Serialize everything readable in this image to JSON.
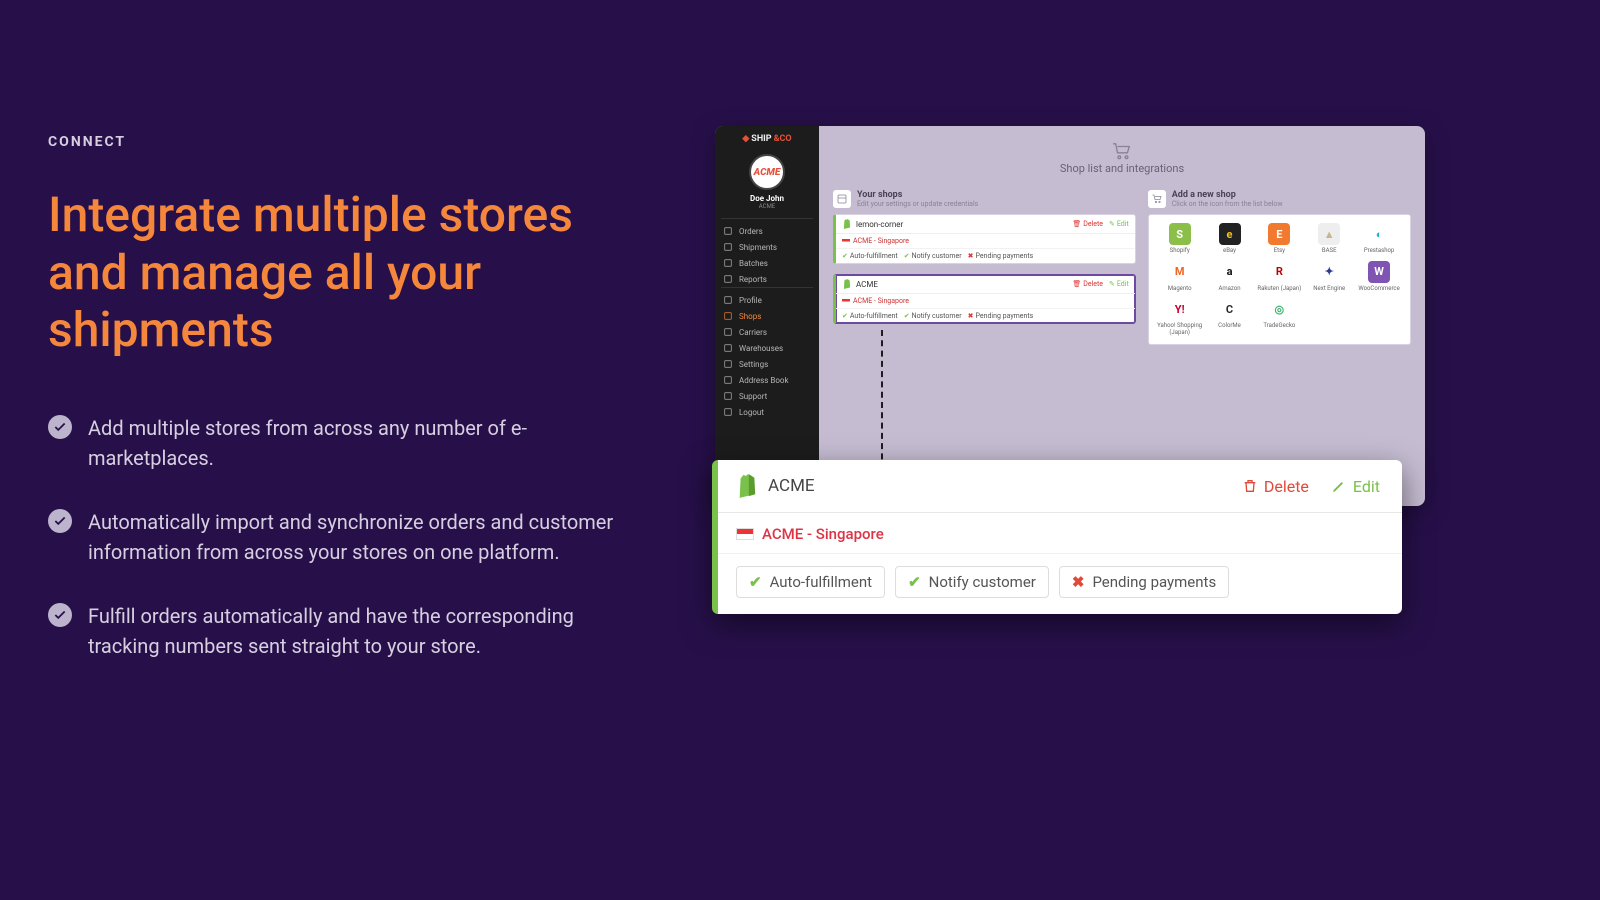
{
  "copy": {
    "eyebrow": "CONNECT",
    "headline": "Integrate multiple stores and manage all your shipments",
    "bullets": [
      "Add multiple stores from across any number of e-marketplaces.",
      "Automatically import and synchronize orders and customer information from across your stores on one platform.",
      "Fulfill orders automatically and have the corresponding tracking numbers sent straight to your store."
    ]
  },
  "screenshot": {
    "logo_a": "SHIP",
    "logo_b": "&CO",
    "avatar": "ACME",
    "user_name": "Doe John",
    "user_sub": "ACME",
    "nav_primary": [
      {
        "icon": "box",
        "label": "Orders"
      },
      {
        "icon": "cube",
        "label": "Shipments"
      },
      {
        "icon": "stack",
        "label": "Batches"
      },
      {
        "icon": "chart",
        "label": "Reports"
      }
    ],
    "nav_secondary": [
      {
        "icon": "user",
        "label": "Profile"
      },
      {
        "icon": "basket",
        "label": "Shops",
        "active": true
      },
      {
        "icon": "truck",
        "label": "Carriers"
      },
      {
        "icon": "home",
        "label": "Warehouses"
      },
      {
        "icon": "gear",
        "label": "Settings"
      },
      {
        "icon": "book",
        "label": "Address Book"
      },
      {
        "icon": "life",
        "label": "Support"
      },
      {
        "icon": "exit",
        "label": "Logout"
      }
    ],
    "main_title": "Shop list and integrations",
    "your_shops": {
      "title": "Your shops",
      "sub": "Edit your settings or update credentials"
    },
    "add_shop": {
      "title": "Add a new shop",
      "sub": "Click on the icon from the list below"
    },
    "actions": {
      "delete": "Delete",
      "edit": "Edit"
    },
    "shops": [
      {
        "name": "lemon-corner",
        "sub": "ACME - Singapore",
        "tags": [
          "Auto-fulfillment",
          "Notify customer",
          "Pending payments"
        ]
      },
      {
        "name": "ACME",
        "sub": "ACME - Singapore",
        "tags": [
          "Auto-fulfillment",
          "Notify customer",
          "Pending payments"
        ]
      }
    ],
    "integrations": [
      {
        "label": "Shopify",
        "glyph": "S",
        "bg": "#8bbf4a",
        "fg": "#fff"
      },
      {
        "label": "eBay",
        "glyph": "e",
        "bg": "#222",
        "fg": "#f5c518"
      },
      {
        "label": "Etsy",
        "glyph": "E",
        "bg": "#f27a2e",
        "fg": "#fff"
      },
      {
        "label": "BASE",
        "glyph": "▲",
        "bg": "#eee",
        "fg": "#c9b58d"
      },
      {
        "label": "Prestashop",
        "glyph": "◐",
        "bg": "#fff",
        "fg": "#27b3c9"
      },
      {
        "label": "Magento",
        "glyph": "M",
        "bg": "#fff",
        "fg": "#f26322"
      },
      {
        "label": "Amazon",
        "glyph": "a",
        "bg": "#fff",
        "fg": "#111"
      },
      {
        "label": "Rakuten (Japan)",
        "glyph": "R",
        "bg": "#fff",
        "fg": "#bf0000"
      },
      {
        "label": "Next Engine",
        "glyph": "✦",
        "bg": "#fff",
        "fg": "#2a3b8f"
      },
      {
        "label": "WooCommerce",
        "glyph": "W",
        "bg": "#7f54b3",
        "fg": "#fff"
      },
      {
        "label": "Yahoo! Shopping (Japan)",
        "glyph": "Y!",
        "bg": "#fff",
        "fg": "#cc0033"
      },
      {
        "label": "ColorMe",
        "glyph": "C",
        "bg": "#fff",
        "fg": "#2a2a2a"
      },
      {
        "label": "TradeGecko",
        "glyph": "◎",
        "bg": "#fff",
        "fg": "#3cb371"
      }
    ]
  },
  "callout": {
    "name": "ACME",
    "sub": "ACME - Singapore",
    "delete": "Delete",
    "edit": "Edit",
    "tags": [
      {
        "label": "Auto-fulfillment",
        "state": "ok"
      },
      {
        "label": "Notify customer",
        "state": "ok"
      },
      {
        "label": "Pending payments",
        "state": "bad"
      }
    ]
  }
}
